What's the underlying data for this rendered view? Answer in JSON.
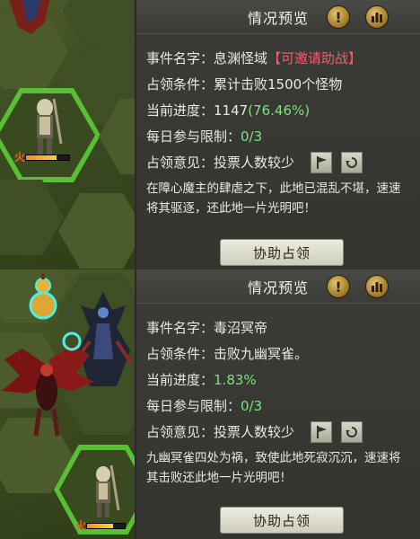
{
  "panels": [
    {
      "title": "情况预览",
      "info_icon": "!",
      "event_label": "事件名字：",
      "event_name": "息渊怪域",
      "event_tag": "【可邀请助战】",
      "condition_label": "占领条件：",
      "condition_value": "累计击败1500个怪物",
      "progress_label": "当前进度：",
      "progress_value": "1147",
      "progress_percent": "(76.46%)",
      "progress_fraction": 0.7646,
      "daily_label": "每日参与限制：",
      "daily_value": "0/3",
      "opinion_label": "占领意见：",
      "opinion_value": "投票人数较少",
      "description": "在障心魔主的肆虐之下，此地已混乱不堪，速速将其驱逐，还此地一片光明吧！",
      "assist_button": "协助占领"
    },
    {
      "title": "情况预览",
      "info_icon": "!",
      "event_label": "事件名字：",
      "event_name": "毒沼冥帝",
      "event_tag": "",
      "condition_label": "占领条件：",
      "condition_value": "击败九幽冥雀。",
      "progress_label": "当前进度：",
      "progress_value": "",
      "progress_percent": "1.83%",
      "progress_fraction": 0.0183,
      "daily_label": "每日参与限制：",
      "daily_value": "0/3",
      "opinion_label": "占领意见：",
      "opinion_value": "投票人数较少",
      "description": "九幽冥雀四处为祸，致使此地死寂沉沉，速速将其击败还此地一片光明吧！",
      "assist_button": "协助占领"
    }
  ],
  "map": {
    "top_char_label": "火",
    "bottom_char_label": "火"
  },
  "colors": {
    "highlight_green": "#57c034",
    "tag_pink": "#f05f6e",
    "progress_green": "#7ee27a",
    "gold_button": "#c9a245"
  }
}
